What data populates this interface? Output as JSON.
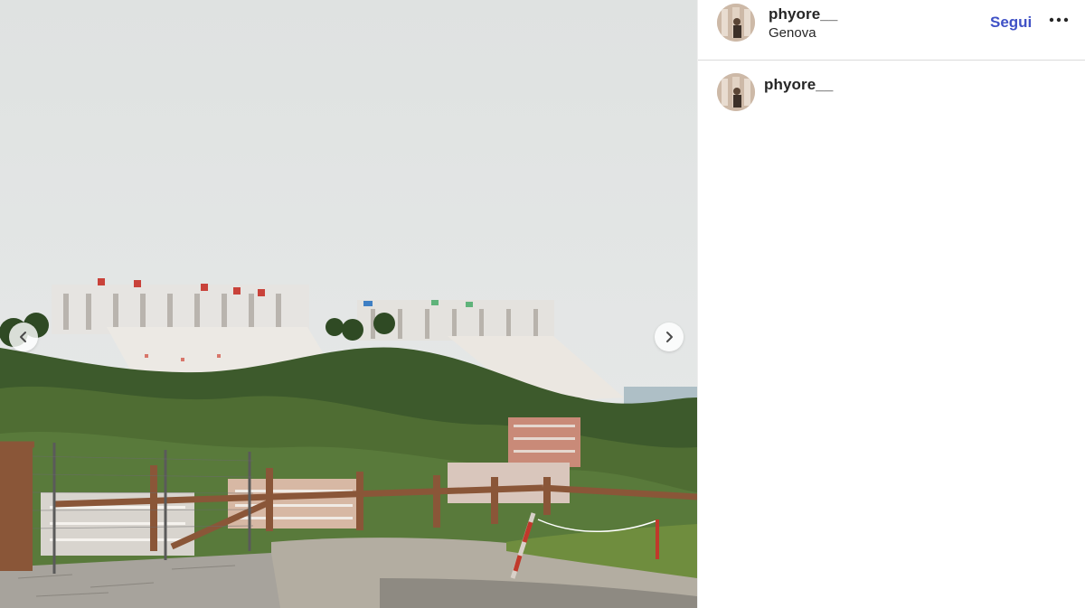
{
  "post": {
    "username": "phyore__",
    "location": "Genova",
    "follow_label": "Segui",
    "more_icon": "more-horizontal-icon"
  },
  "caption": {
    "username": "phyore__"
  },
  "carousel": {
    "prev_icon": "chevron-left-icon",
    "next_icon": "chevron-right-icon"
  },
  "colors": {
    "follow_blue": "#3f51c6",
    "text": "#262626",
    "divider": "#dbdbdb"
  }
}
